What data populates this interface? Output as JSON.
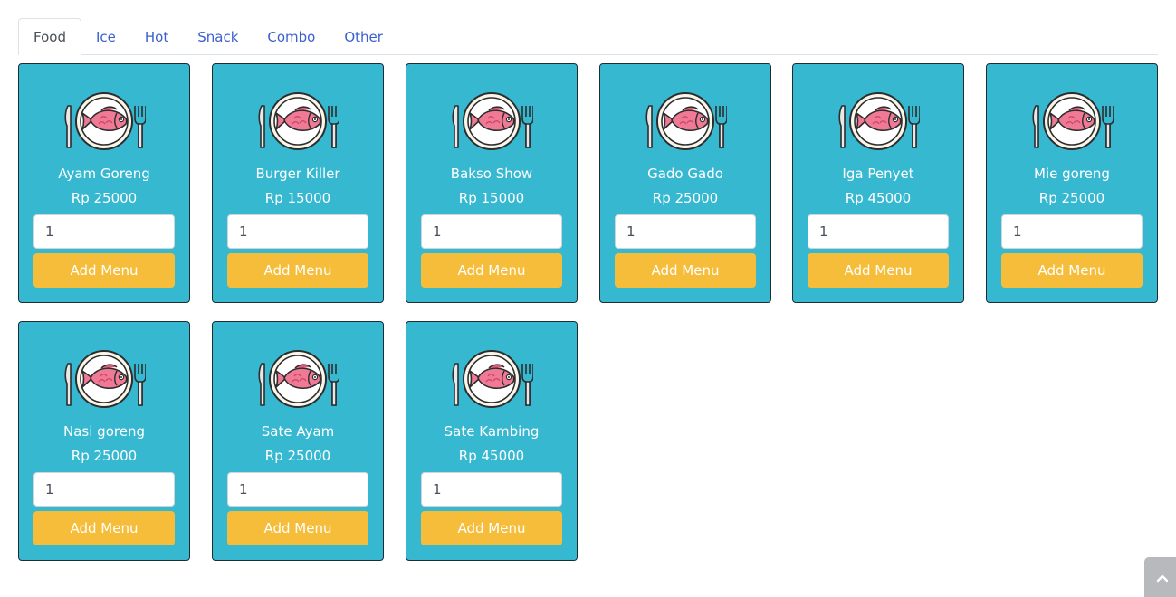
{
  "tabs": [
    {
      "label": "Food",
      "active": true
    },
    {
      "label": "Ice",
      "active": false
    },
    {
      "label": "Hot",
      "active": false
    },
    {
      "label": "Snack",
      "active": false
    },
    {
      "label": "Combo",
      "active": false
    },
    {
      "label": "Other",
      "active": false
    }
  ],
  "menu_items": [
    {
      "name": "Ayam Goreng",
      "price": "Rp 25000",
      "qty": "1",
      "button": "Add Menu",
      "icon": "fish-plate-icon"
    },
    {
      "name": "Burger Killer",
      "price": "Rp 15000",
      "qty": "1",
      "button": "Add Menu",
      "icon": "fish-plate-icon"
    },
    {
      "name": "Bakso Show",
      "price": "Rp 15000",
      "qty": "1",
      "button": "Add Menu",
      "icon": "fish-plate-icon"
    },
    {
      "name": "Gado Gado",
      "price": "Rp 25000",
      "qty": "1",
      "button": "Add Menu",
      "icon": "fish-plate-icon"
    },
    {
      "name": "Iga Penyet",
      "price": "Rp 45000",
      "qty": "1",
      "button": "Add Menu",
      "icon": "fish-plate-icon"
    },
    {
      "name": "Mie goreng",
      "price": "Rp 25000",
      "qty": "1",
      "button": "Add Menu",
      "icon": "fish-plate-icon"
    },
    {
      "name": "Nasi goreng",
      "price": "Rp 25000",
      "qty": "1",
      "button": "Add Menu",
      "icon": "fish-plate-icon"
    },
    {
      "name": "Sate Ayam",
      "price": "Rp 25000",
      "qty": "1",
      "button": "Add Menu",
      "icon": "fish-plate-icon"
    },
    {
      "name": "Sate Kambing",
      "price": "Rp 45000",
      "qty": "1",
      "button": "Add Menu",
      "icon": "fish-plate-icon"
    }
  ],
  "scroll_top_icon": "chevron-up-icon",
  "colors": {
    "card_bg": "#36b8d1",
    "button_bg": "#f5bd3a",
    "tab_link": "#3b5fcf",
    "fish": "#f07a96"
  }
}
